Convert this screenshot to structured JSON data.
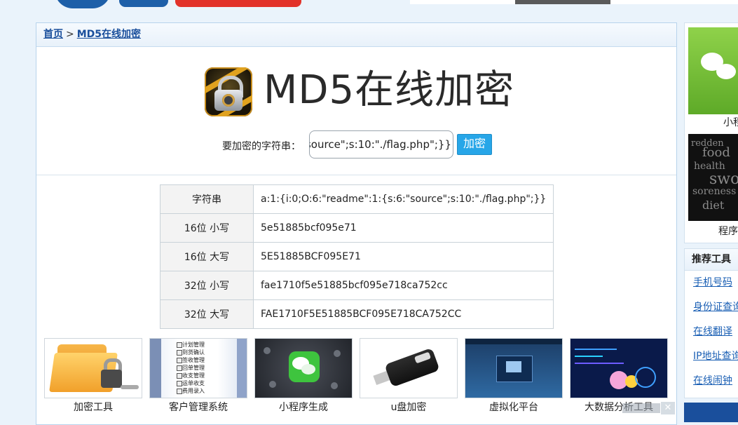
{
  "breadcrumb": {
    "home": "首页",
    "sep": ">",
    "current": "MD5在线加密"
  },
  "hero": {
    "title": "MD5在线加密",
    "icon": "lock-icon"
  },
  "form": {
    "label": "要加密的字符串：",
    "input_value": "a:1:{i:0;O:6:\"readme\":1:{s:6:\"source\";s:10:\"./flag.php\";}}",
    "input_visible": "source\";s:10:\"./flag.php\";}}",
    "button": "加密"
  },
  "results": [
    {
      "key": "字符串",
      "value": "a:1:{i:0;O:6:\"readme\":1:{s:6:\"source\";s:10:\"./flag.php\";}}"
    },
    {
      "key": "16位 小写",
      "value": "5e51885bcf095e71"
    },
    {
      "key": "16位 大写",
      "value": "5E51885BCF095E71"
    },
    {
      "key": "32位 小写",
      "value": "fae1710f5e51885bcf095e718ca752cc"
    },
    {
      "key": "32位 大写",
      "value": "FAE1710F5E51885BCF095E718CA752CC"
    }
  ],
  "tools": [
    {
      "label": "加密工具"
    },
    {
      "label": "客户管理系统",
      "lines": [
        "计划管理",
        "到货确认",
        "签收管理",
        "回单管理",
        "收支管理",
        "运单收支",
        "费用录入"
      ]
    },
    {
      "label": "小程序生成"
    },
    {
      "label": "u盘加密"
    },
    {
      "label": "虚拟化平台"
    },
    {
      "label": "大数据分析工具"
    }
  ],
  "sidebar": {
    "card1_caption": "小程",
    "card2_caption": "程序",
    "card2_words": [
      "redden",
      "food",
      "health",
      "swollen",
      "soreness",
      "diet"
    ],
    "recommend_title": "推荐工具",
    "links": [
      "手机号码",
      "身份证查询",
      "在线翻译",
      "IP地址查询",
      "在线闹钟"
    ]
  },
  "close_label": "✕",
  "colors": {
    "accent": "#27a6e8",
    "link": "#1a4f9c",
    "border": "#b7d3ec"
  }
}
